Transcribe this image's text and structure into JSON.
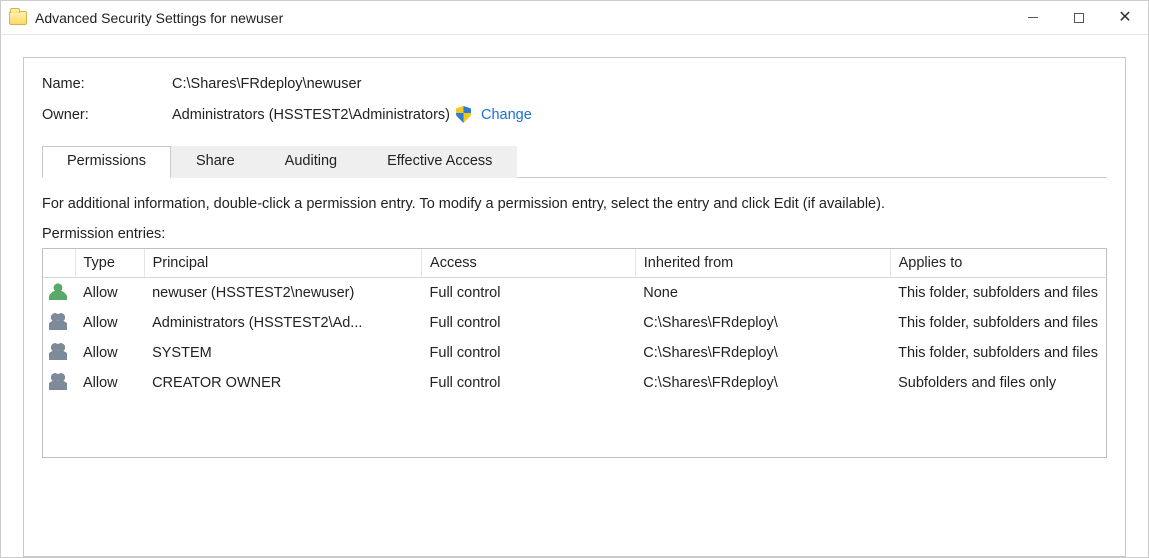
{
  "window": {
    "title": "Advanced Security Settings for newuser"
  },
  "info": {
    "name_label": "Name:",
    "name_value": "C:\\Shares\\FRdeploy\\newuser",
    "owner_label": "Owner:",
    "owner_value": "Administrators (HSSTEST2\\Administrators)",
    "change_label": "Change"
  },
  "tabs": {
    "permissions": "Permissions",
    "share": "Share",
    "auditing": "Auditing",
    "effective": "Effective Access"
  },
  "hint": "For additional information, double-click a permission entry. To modify a permission entry, select the entry and click Edit (if available).",
  "entries_label": "Permission entries:",
  "columns": {
    "type": "Type",
    "principal": "Principal",
    "access": "Access",
    "inherited": "Inherited from",
    "applies": "Applies to"
  },
  "rows": [
    {
      "icon": "user",
      "type": "Allow",
      "principal": "newuser (HSSTEST2\\newuser)",
      "access": "Full control",
      "inherited": "None",
      "applies": "This folder, subfolders and files"
    },
    {
      "icon": "group",
      "type": "Allow",
      "principal": "Administrators (HSSTEST2\\Ad...",
      "access": "Full control",
      "inherited": "C:\\Shares\\FRdeploy\\",
      "applies": "This folder, subfolders and files"
    },
    {
      "icon": "group",
      "type": "Allow",
      "principal": "SYSTEM",
      "access": "Full control",
      "inherited": "C:\\Shares\\FRdeploy\\",
      "applies": "This folder, subfolders and files"
    },
    {
      "icon": "group",
      "type": "Allow",
      "principal": "CREATOR OWNER",
      "access": "Full control",
      "inherited": "C:\\Shares\\FRdeploy\\",
      "applies": "Subfolders and files only"
    }
  ]
}
